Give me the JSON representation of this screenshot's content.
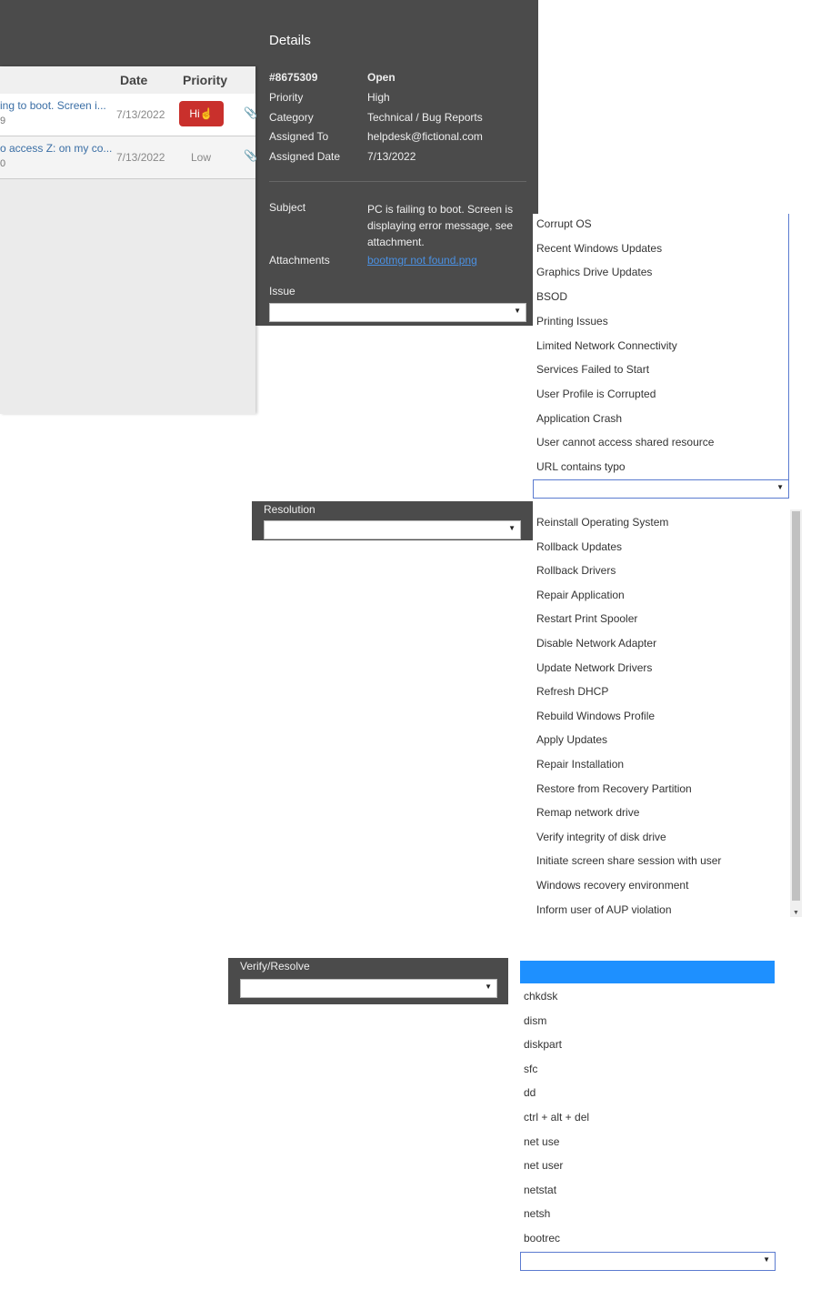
{
  "details": {
    "title": "Details",
    "ticket_id": "#8675309",
    "status": "Open",
    "fields": [
      {
        "label": "Priority",
        "value": "High"
      },
      {
        "label": "Category",
        "value": "Technical / Bug Reports"
      },
      {
        "label": "Assigned To",
        "value": "helpdesk@fictional.com"
      },
      {
        "label": "Assigned Date",
        "value": "7/13/2022"
      }
    ],
    "subject_label": "Subject",
    "subject_lines": [
      "PC is failing to boot. Screen is",
      "displaying error message, see",
      "attachment."
    ],
    "attachments_label": "Attachments",
    "attachment": "bootmgr not found.png",
    "issue_label": "Issue"
  },
  "table": {
    "headers": {
      "date": "Date",
      "priority": "Priority"
    },
    "rows": [
      {
        "subject": "ing to boot. Screen i...",
        "num": "9",
        "date": "7/13/2022",
        "priority": "High",
        "priority_shown": "Hi"
      },
      {
        "subject": "o access Z: on my co...",
        "num": "0",
        "date": "7/13/2022",
        "priority": "Low"
      }
    ]
  },
  "issue_options": [
    "Corrupt OS",
    "Recent Windows Updates",
    "Graphics Drive Updates",
    "BSOD",
    "Printing Issues",
    "Limited Network Connectivity",
    "Services Failed to Start",
    "User Profile is Corrupted",
    "Application Crash",
    "User cannot access shared resource",
    "URL contains typo"
  ],
  "resolution": {
    "label": "Resolution",
    "options": [
      "Reinstall Operating System",
      "Rollback Updates",
      "Rollback Drivers",
      "Repair Application",
      "Restart Print Spooler",
      "Disable Network Adapter",
      "Update Network Drivers",
      "Refresh DHCP",
      "Rebuild Windows Profile",
      "Apply Updates",
      "Repair Installation",
      "Restore from Recovery Partition",
      "Remap network drive",
      "Verify integrity of disk drive",
      "Initiate screen share session with user",
      "Windows recovery environment",
      "Inform user of AUP violation"
    ]
  },
  "verify": {
    "label": "Verify/Resolve",
    "options": [
      "chkdsk",
      "dism",
      "diskpart",
      "sfc",
      "dd",
      "ctrl + alt + del",
      "net use",
      "net user",
      "netstat",
      "netsh",
      "bootrec"
    ]
  },
  "colors": {
    "panel": "#4b4b4b",
    "high_badge": "#c9302c",
    "highlight": "#1e90ff",
    "link": "#4a90e2"
  }
}
